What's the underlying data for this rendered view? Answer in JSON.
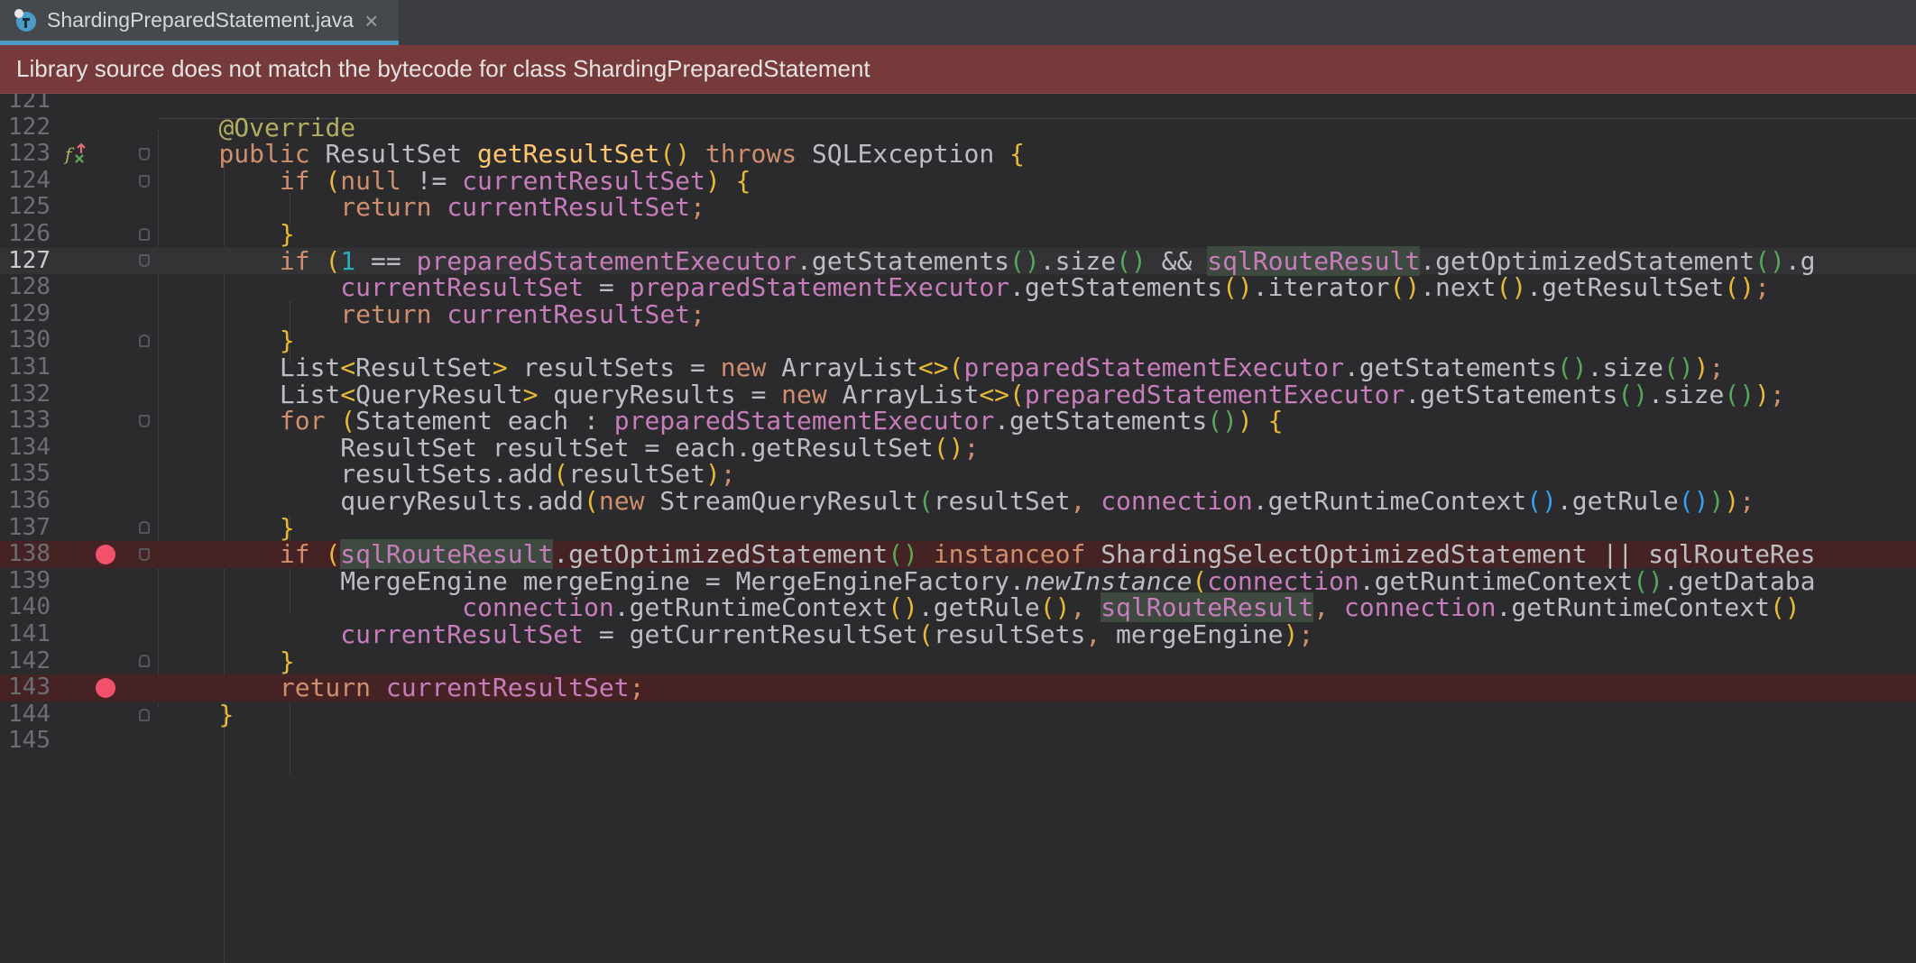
{
  "tab": {
    "filename": "ShardingPreparedStatement.java",
    "close_symbol": "×"
  },
  "banner": {
    "message": "Library source does not match the bytecode for class ShardingPreparedStatement"
  },
  "editor": {
    "current_line": "127",
    "breakpoint_lines": [
      "138",
      "143"
    ],
    "lines": [
      {
        "n": "121",
        "code": ""
      },
      {
        "n": "122",
        "code": "    @Override"
      },
      {
        "n": "123",
        "code": "    public ResultSet getResultSet() throws SQLException {"
      },
      {
        "n": "124",
        "code": "        if (null != currentResultSet) {"
      },
      {
        "n": "125",
        "code": "            return currentResultSet;"
      },
      {
        "n": "126",
        "code": "        }"
      },
      {
        "n": "127",
        "code": "        if (1 == preparedStatementExecutor.getStatements().size() && sqlRouteResult.getOptimizedStatement().g"
      },
      {
        "n": "128",
        "code": "            currentResultSet = preparedStatementExecutor.getStatements().iterator().next().getResultSet();"
      },
      {
        "n": "129",
        "code": "            return currentResultSet;"
      },
      {
        "n": "130",
        "code": "        }"
      },
      {
        "n": "131",
        "code": "        List<ResultSet> resultSets = new ArrayList<>(preparedStatementExecutor.getStatements().size());"
      },
      {
        "n": "132",
        "code": "        List<QueryResult> queryResults = new ArrayList<>(preparedStatementExecutor.getStatements().size());"
      },
      {
        "n": "133",
        "code": "        for (Statement each : preparedStatementExecutor.getStatements()) {"
      },
      {
        "n": "134",
        "code": "            ResultSet resultSet = each.getResultSet();"
      },
      {
        "n": "135",
        "code": "            resultSets.add(resultSet);"
      },
      {
        "n": "136",
        "code": "            queryResults.add(new StreamQueryResult(resultSet, connection.getRuntimeContext().getRule()));"
      },
      {
        "n": "137",
        "code": "        }"
      },
      {
        "n": "138",
        "code": "        if (sqlRouteResult.getOptimizedStatement() instanceof ShardingSelectOptimizedStatement || sqlRouteRes"
      },
      {
        "n": "139",
        "code": "            MergeEngine mergeEngine = MergeEngineFactory.newInstance(connection.getRuntimeContext().getDataba"
      },
      {
        "n": "140",
        "code": "                    connection.getRuntimeContext().getRule(), sqlRouteResult, connection.getRuntimeContext()"
      },
      {
        "n": "141",
        "code": "            currentResultSet = getCurrentResultSet(resultSets, mergeEngine);"
      },
      {
        "n": "142",
        "code": "        }"
      },
      {
        "n": "143",
        "code": "        return currentResultSet;"
      },
      {
        "n": "144",
        "code": "    }"
      },
      {
        "n": "145",
        "code": ""
      }
    ]
  },
  "colors": {
    "background": "#2b2b2d",
    "banner_bg": "#773a3b",
    "tab_underline": "#4b9bc7",
    "keyword": "#cf8e6d",
    "field": "#c77dbb",
    "method": "#56a8f5",
    "annotation": "#b3ae60",
    "breakpoint": "#f2506b"
  },
  "icons": {
    "tab": "java-class-icon",
    "gutter_123": "implements-method-icon",
    "breakpoint": "breakpoint-icon",
    "fold": "fold-marker-icon"
  }
}
